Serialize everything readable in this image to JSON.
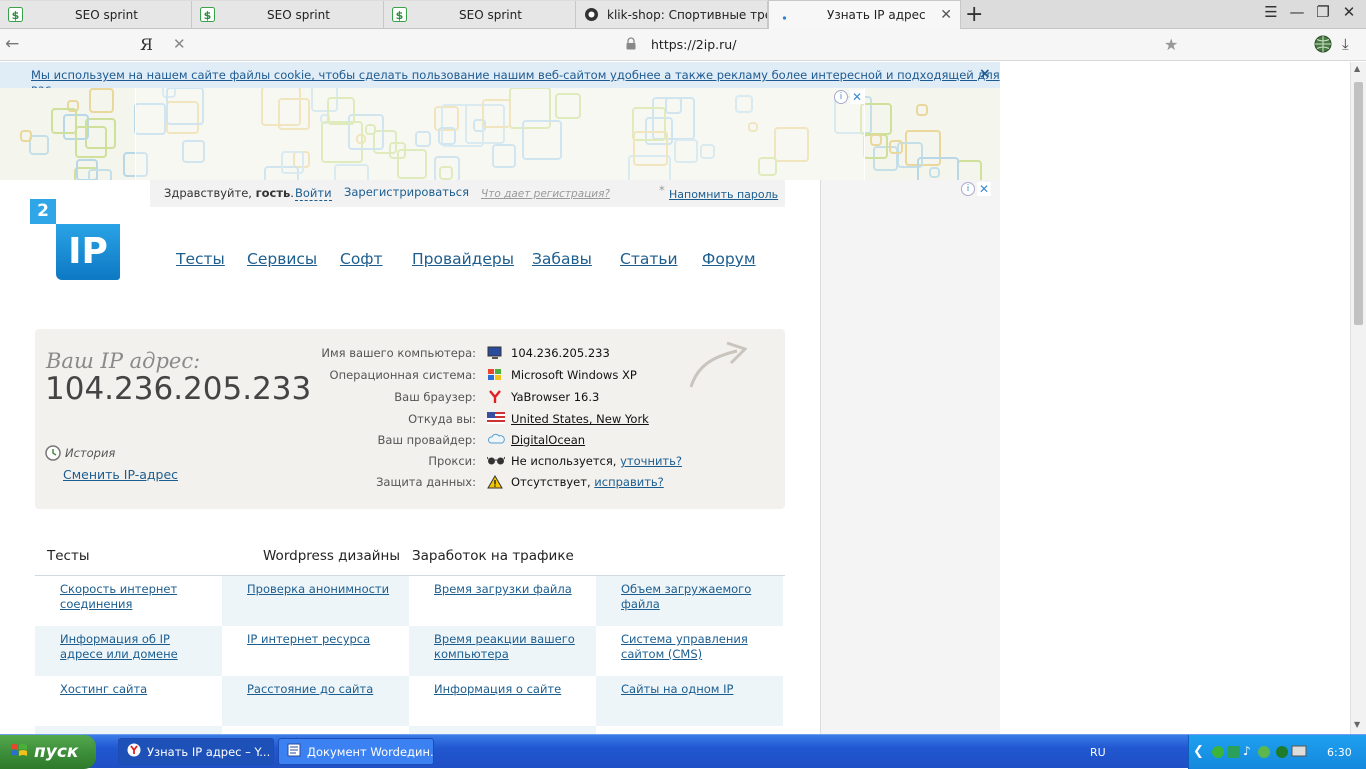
{
  "browser": {
    "tabs": [
      {
        "title": "SEO sprint",
        "icon": "seosprint-icon"
      },
      {
        "title": "SEO sprint",
        "icon": "seosprint-icon"
      },
      {
        "title": "SEO sprint",
        "icon": "seosprint-icon"
      },
      {
        "title": "klik-shop: Спортивные трена",
        "icon": "klikshop-icon"
      },
      {
        "title": "Узнать IP адрес",
        "icon": "loading-icon",
        "active": true
      }
    ],
    "new_tab": "+",
    "address_bar": {
      "yandex_button": "Я",
      "url": "https://2ip.ru/"
    }
  },
  "cookie_notice": {
    "text": "Мы используем на нашем сайте файлы cookie, чтобы сделать пользование нашим веб-сайтом удобнее а также рекламу более интересной и подходящей для вас.",
    "close": "×"
  },
  "userbar": {
    "greeting_prefix": "Здравствуйте,",
    "guest": "гость",
    "greeting_suffix": ".",
    "login": "Войти",
    "register": "Зарегистрироваться",
    "why_register": "Что дает регистрация?",
    "asterisk": "*",
    "remind_password": "Напомнить пароль"
  },
  "logo": {
    "top": "2",
    "main": "IP"
  },
  "nav": [
    "Тесты",
    "Сервисы",
    "Софт",
    "Провайдеры",
    "Забавы",
    "Статьи",
    "Форум"
  ],
  "ip_panel": {
    "heading": "Ваш IP адрес:",
    "ip": "104.236.205.233",
    "history": "История",
    "change_ip": "Сменить IP-адрес",
    "rows": [
      {
        "label": "Имя вашего компьютера:",
        "value": "104.236.205.233",
        "icon": "computer-icon"
      },
      {
        "label": "Операционная система:",
        "value": "Microsoft Windows XP",
        "icon": "windows-icon"
      },
      {
        "label": "Ваш браузер:",
        "value": "YaBrowser 16.3",
        "icon": "yandex-browser-icon"
      },
      {
        "label": "Откуда вы:",
        "value": "United States, New York",
        "icon": "us-flag-icon",
        "link": true
      },
      {
        "label": "Ваш провайдер:",
        "value": "DigitalOcean",
        "icon": "cloud-icon",
        "link": true
      },
      {
        "label": "Прокси:",
        "value": "Не используется,",
        "extra": "уточнить?",
        "icon": "glasses-icon"
      },
      {
        "label": "Защита данных:",
        "value": "Отсутствует,",
        "extra": "исправить?",
        "icon": "warning-icon"
      }
    ]
  },
  "columns": [
    "Тесты",
    "Wordpress дизайны",
    "Заработок на трафике"
  ],
  "tests_grid": [
    [
      "Скорость интернет соединения",
      "Проверка анонимности",
      "Время загрузки файла",
      "Объем загружаемого файла"
    ],
    [
      "Информация об IP адресе или домене",
      "IP интернет ресурса",
      "Время реакции вашего компьютера",
      "Система управления сайтом (CMS)"
    ],
    [
      "Хостинг сайта",
      "Расстояние до сайта",
      "Информация о сайте",
      "Сайты на одном IP"
    ]
  ],
  "taskbar": {
    "start": "пуск",
    "items": [
      "Узнать IP адрес – Y...",
      "Документ Wordедин..."
    ],
    "lang": "RU",
    "clock": "6:30"
  }
}
